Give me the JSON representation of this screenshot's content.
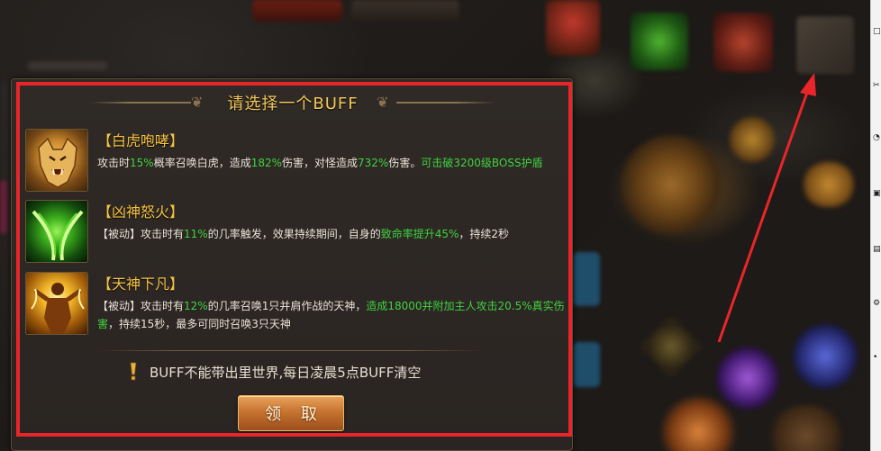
{
  "dialog": {
    "title": "请选择一个BUFF",
    "buffs": [
      {
        "name": "【白虎咆哮】",
        "desc_parts": [
          {
            "text": "攻击时",
            "green": false
          },
          {
            "text": "15%",
            "green": true
          },
          {
            "text": "概率召唤白虎，造成",
            "green": false
          },
          {
            "text": "182%",
            "green": true
          },
          {
            "text": "伤害，对怪造成",
            "green": false
          },
          {
            "text": "732%",
            "green": true
          },
          {
            "text": "伤害。",
            "green": false
          },
          {
            "text": "可击破3200级BOSS护盾",
            "green": true
          }
        ],
        "icon": "white-tiger-icon"
      },
      {
        "name": "【凶神怒火】",
        "desc_parts": [
          {
            "text": "【被动】攻击时有",
            "green": false
          },
          {
            "text": "11%",
            "green": true
          },
          {
            "text": "的几率触发，效果持续期间，自身的",
            "green": false
          },
          {
            "text": "致命率提升45%",
            "green": true
          },
          {
            "text": "，持续2秒",
            "green": false
          }
        ],
        "icon": "green-blade-icon"
      },
      {
        "name": "【天神下凡】",
        "desc_parts": [
          {
            "text": "【被动】攻击时有",
            "green": false
          },
          {
            "text": "12%",
            "green": true
          },
          {
            "text": "的几率召唤1只并肩作战的天神，",
            "green": false
          },
          {
            "text": "造成18000并附加主人攻击20.5%真实伤害",
            "green": true
          },
          {
            "text": "，持续15秒，最多可同时召唤3只天神",
            "green": false
          }
        ],
        "icon": "golden-deity-icon"
      }
    ],
    "notice": "BUFF不能带出里世界,每日凌晨5点BUFF清空",
    "claim_label": "领 取"
  },
  "colors": {
    "title": "#f3c75a",
    "buff_name": "#f5c242",
    "highlight": "#3fd23f",
    "annotation": "#e8262a"
  }
}
